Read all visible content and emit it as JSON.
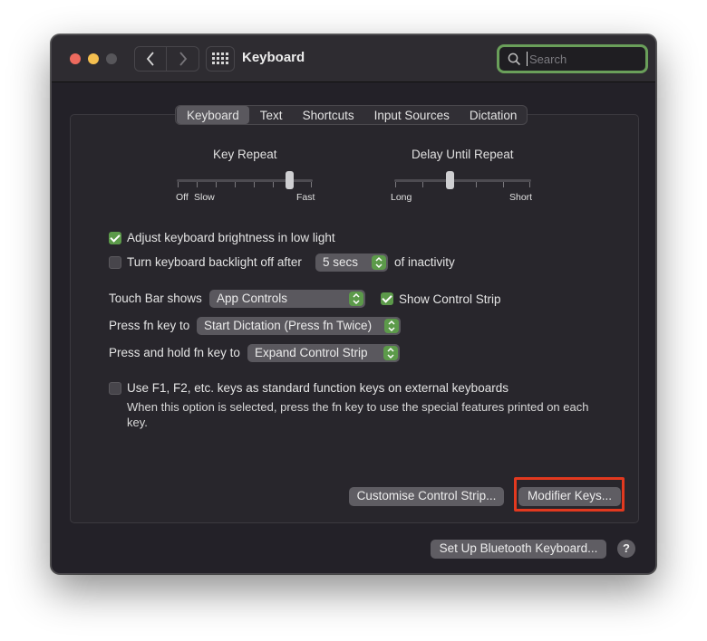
{
  "window": {
    "title": "Keyboard"
  },
  "search": {
    "placeholder": "Search"
  },
  "tabs": [
    "Keyboard",
    "Text",
    "Shortcuts",
    "Input Sources",
    "Dictation"
  ],
  "active_tab": "Keyboard",
  "sliders": {
    "key_repeat": {
      "label": "Key Repeat",
      "min_labels": [
        "Off",
        "Slow"
      ],
      "max_label": "Fast",
      "value": 0.85
    },
    "delay_until_repeat": {
      "label": "Delay Until Repeat",
      "min_label": "Long",
      "max_label": "Short",
      "value": 0.4
    }
  },
  "options": {
    "adjust_brightness": {
      "label": "Adjust keyboard brightness in low light",
      "checked": true
    },
    "backlight_off": {
      "label": "Turn keyboard backlight off after",
      "checked": false,
      "duration": "5 secs",
      "suffix": "of inactivity"
    },
    "touch_bar": {
      "label": "Touch Bar shows",
      "value": "App Controls"
    },
    "show_control_strip": {
      "label": "Show Control Strip",
      "checked": true
    },
    "fn_key": {
      "label": "Press fn key to",
      "value": "Start Dictation (Press fn Twice)"
    },
    "hold_fn": {
      "label": "Press and hold fn key to",
      "value": "Expand Control Strip"
    },
    "function_keys": {
      "label": "Use F1, F2, etc. keys as standard function keys on external keyboards",
      "description": "When this option is selected, press the fn key to use the special features printed on each key.",
      "checked": false
    }
  },
  "buttons": {
    "customise": "Customise Control Strip...",
    "modifier": "Modifier Keys...",
    "bluetooth": "Set Up Bluetooth Keyboard...",
    "help": "?"
  },
  "colors": {
    "accent": "#5c9a4a",
    "highlight": "#e2391f",
    "search_focus": "#6a9f5a"
  }
}
